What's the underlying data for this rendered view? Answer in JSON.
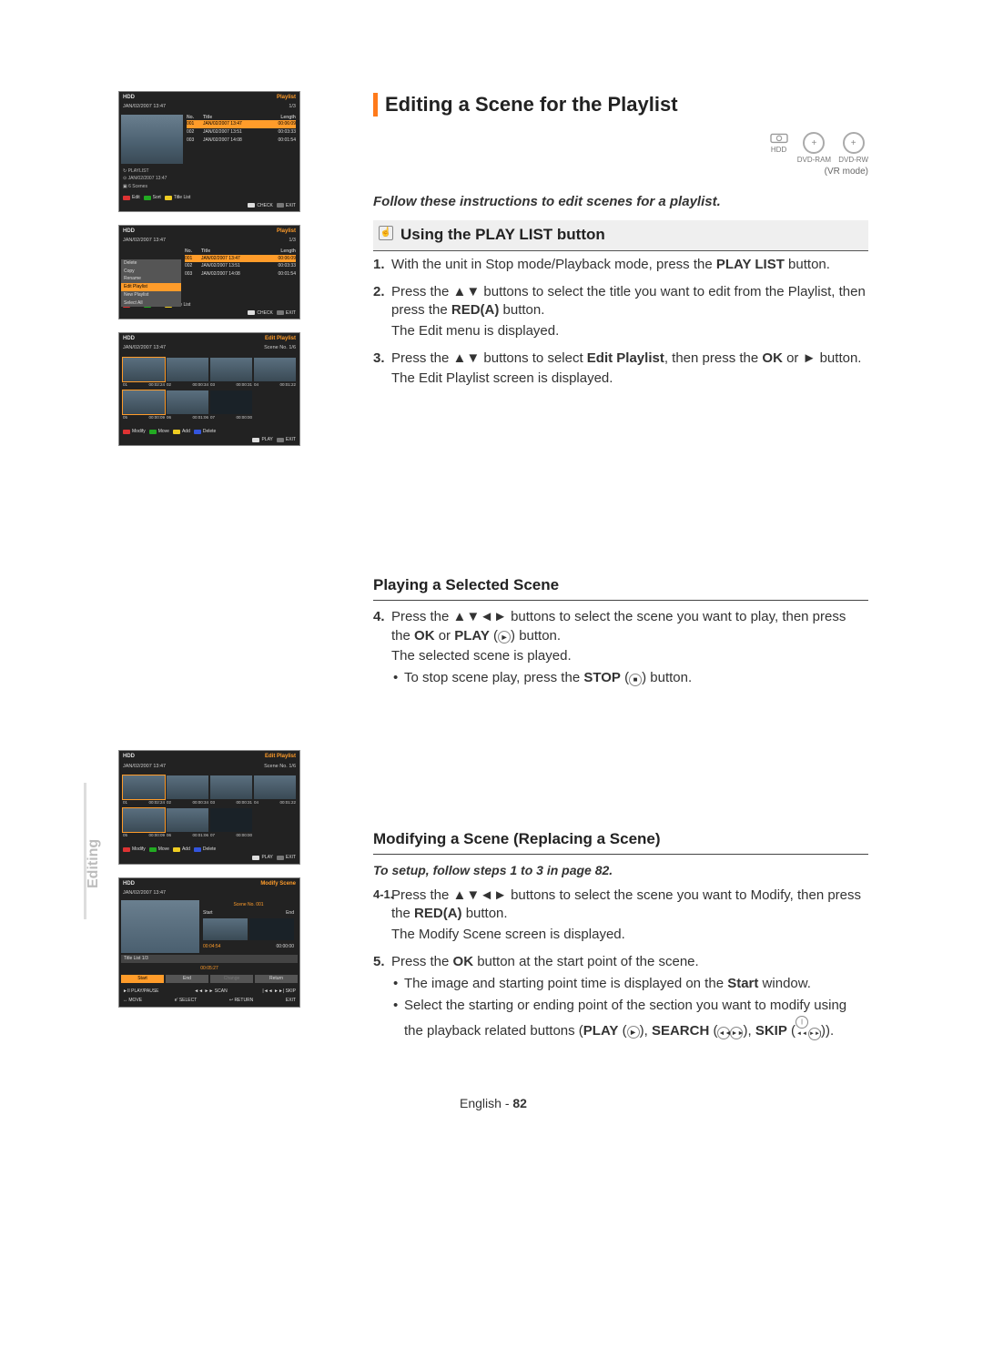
{
  "side_tab": "Editing",
  "main_heading": "Editing a Scene for the Playlist",
  "devices": {
    "hdd": "HDD",
    "ram": "DVD-RAM",
    "rw": "DVD-RW",
    "vrmode": "(VR mode)"
  },
  "instr": "Follow these instructions to edit scenes for a playlist.",
  "sub_heading": "Using the PLAY LIST button",
  "steps_play": {
    "s1": {
      "num": "1.",
      "text": "With the unit in Stop mode/Playback mode, press the ",
      "btn": "PLAY LIST",
      "text2": " button."
    },
    "s2": {
      "num": "2.",
      "t1": "Press the ▲▼ buttons to select the title you want to edit from the Playlist, then press the ",
      "btn": "RED(A)",
      "t2": " button.",
      "line2": "The Edit menu is displayed."
    },
    "s3": {
      "num": "3.",
      "t1": "Press the ▲▼ buttons to select ",
      "sel": "Edit Playlist",
      "t2": ", then press the ",
      "ok": "OK",
      "t3": " or ► button.",
      "line2": "The Edit Playlist screen is displayed."
    }
  },
  "mid_playing": "Playing a Selected Scene",
  "steps_playing": {
    "s4": {
      "num": "4.",
      "t1": "Press the ▲▼◄► buttons to select the scene you want to play, then press the ",
      "ok": "OK",
      "t2": " or ",
      "play": "PLAY",
      "t3": " (",
      "icon": "►",
      "t4": ") button.",
      "line2": "The selected scene is played.",
      "bullet": {
        "t1": "To stop scene play, press the ",
        "stop": "STOP",
        "t2": " (",
        "icon": "■",
        "t3": ") button."
      }
    }
  },
  "mid_modify": "Modifying a Scene (Replacing a Scene)",
  "setup_note": "To setup, follow steps 1 to 3 in page 82.",
  "steps_modify": {
    "s4": {
      "num": "4-1.",
      "t1": "Press the ▲▼◄► buttons to select the scene you want to Modify, then press the ",
      "btn": "RED(A)",
      "t2": " button.",
      "line2": "The Modify Scene screen is displayed."
    },
    "s5": {
      "num": "5.",
      "t1": "Press the ",
      "ok": "OK",
      "t2": " button at the start point of the scene.",
      "b1": {
        "t1": "The image and starting point time is displayed on the ",
        "start": "Start",
        "t2": " window."
      },
      "b2": {
        "t1": "Select the starting or ending point of the section you want to modify using the playback related buttons (",
        "play": "PLAY",
        "t2": " (",
        "i1": "►",
        "t3": "), ",
        "search": "SEARCH",
        "t4": " (",
        "i2": "◄◄",
        "i3": "►►",
        "t5": "), ",
        "skip": "SKIP",
        "t6": " (",
        "i4": "|◄◄",
        "i5": "►►|",
        "t7": "))."
      }
    }
  },
  "footer": {
    "lang": "English",
    "sep": " - ",
    "page": "82"
  },
  "osd_labels": {
    "hdd": "HDD",
    "playlist": "Playlist",
    "date": "JAN/02/2007 13:47",
    "count": "1/3",
    "no": "No.",
    "title": "Title",
    "length": "Length",
    "r1": {
      "n": "001",
      "t": "JAN/02/2007 13:47",
      "l": "00:06:09"
    },
    "r2": {
      "n": "002",
      "t": "JAN/02/2007 13:51",
      "l": "00:03:33"
    },
    "r3": {
      "n": "003",
      "t": "JAN/02/2007 14:08",
      "l": "00:01:54"
    },
    "meta1": "↻ PLAYLIST",
    "meta2": "⊙ JAN/02/2007 13:47",
    "meta3": "▣ 6 Scenes",
    "edit": "Edit",
    "sort": "Sort",
    "titlelist": "Title List",
    "check": "CHECK",
    "exit": "EXIT",
    "eselect": "e'",
    "context": {
      "delete": "Delete",
      "copy": "Copy",
      "rename": "Rename",
      "editpl": "Edit Playlist",
      "newpl": "New Playlist",
      "selall": "Select All"
    },
    "editpl_label": "Edit Playlist",
    "sceneno": "Scene No. 1/6",
    "scenes": {
      "s1": {
        "n": "01",
        "t": "00:02:24"
      },
      "s2": {
        "n": "02",
        "t": "00:00:34"
      },
      "s3": {
        "n": "03",
        "t": "00:00:31"
      },
      "s4": {
        "n": "04",
        "t": "00:01:22"
      },
      "s5": {
        "n": "05",
        "t": "00:00:09"
      },
      "s6": {
        "n": "06",
        "t": "00:01:06"
      },
      "s7": {
        "n": "07",
        "t": "00:00:00"
      }
    },
    "modify": "Modify",
    "move": "Move",
    "add": "Add",
    "delete": "Delete",
    "play": "PLAY",
    "modscene": "Modify Scene",
    "sceneno1": "Scene No. 001",
    "start": "Start",
    "end": "End",
    "t04": "00:04:54",
    "t00": "00:00:00",
    "t0527": "00:05:27",
    "titlelist13": "Title List  1/3",
    "btn_start": "Start",
    "btn_end": "End",
    "btn_change": "Change",
    "btn_return": "Return",
    "playpause": "►II PLAY/PAUSE",
    "scan": "◄◄ ►► SCAN",
    "skip": "|◄◄ ►►| SKIP",
    "movebtn": "↔ MOVE",
    "select": "e' SELECT",
    "return": "↩ RETURN"
  }
}
